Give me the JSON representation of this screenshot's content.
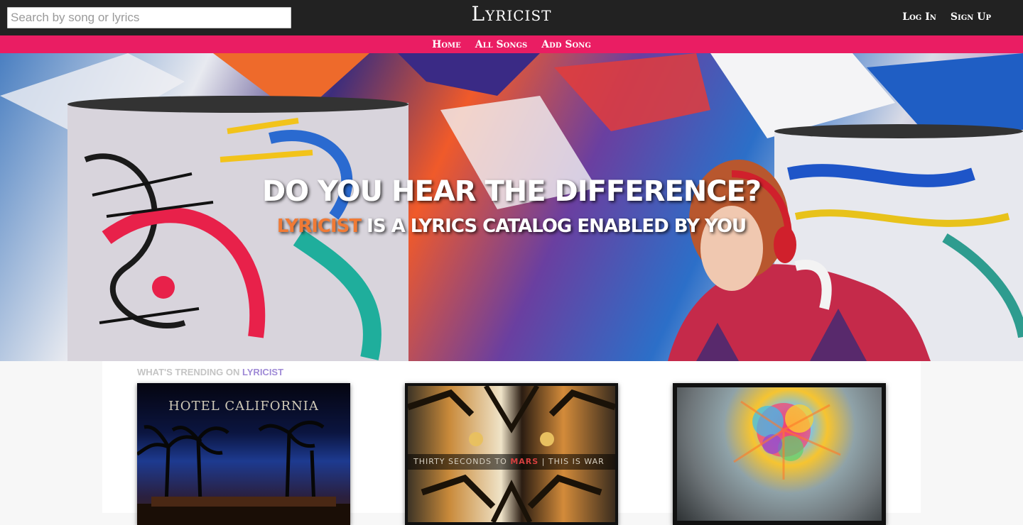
{
  "header": {
    "search_placeholder": "Search by song or lyrics",
    "brand": "Lyricist",
    "login_label": "Log In",
    "signup_label": "Sign Up"
  },
  "nav": {
    "items": [
      {
        "label": "Home"
      },
      {
        "label": "All Songs"
      },
      {
        "label": "Add Song"
      }
    ]
  },
  "hero": {
    "heading": "DO YOU HEAR THE DIFFERENCE?",
    "sub_accent": "LYRICIST",
    "sub_rest": " IS A LYRICS CATALOG ENABLED BY YOU"
  },
  "trending": {
    "label_prefix": "WHAT'S TRENDING ON ",
    "label_accent": "LYRICIST",
    "cards": [
      {
        "title": "HOTEL CALIFORNIA"
      },
      {
        "band_prefix": "THIRTY SECONDS TO ",
        "band_accent": "MARS",
        "band_suffix": " | THIS IS WAR"
      },
      {}
    ]
  },
  "colors": {
    "topbar": "#222222",
    "nav": "#ea1d63",
    "accent_orange": "#f07a35",
    "accent_purple": "#9f8ad6"
  }
}
